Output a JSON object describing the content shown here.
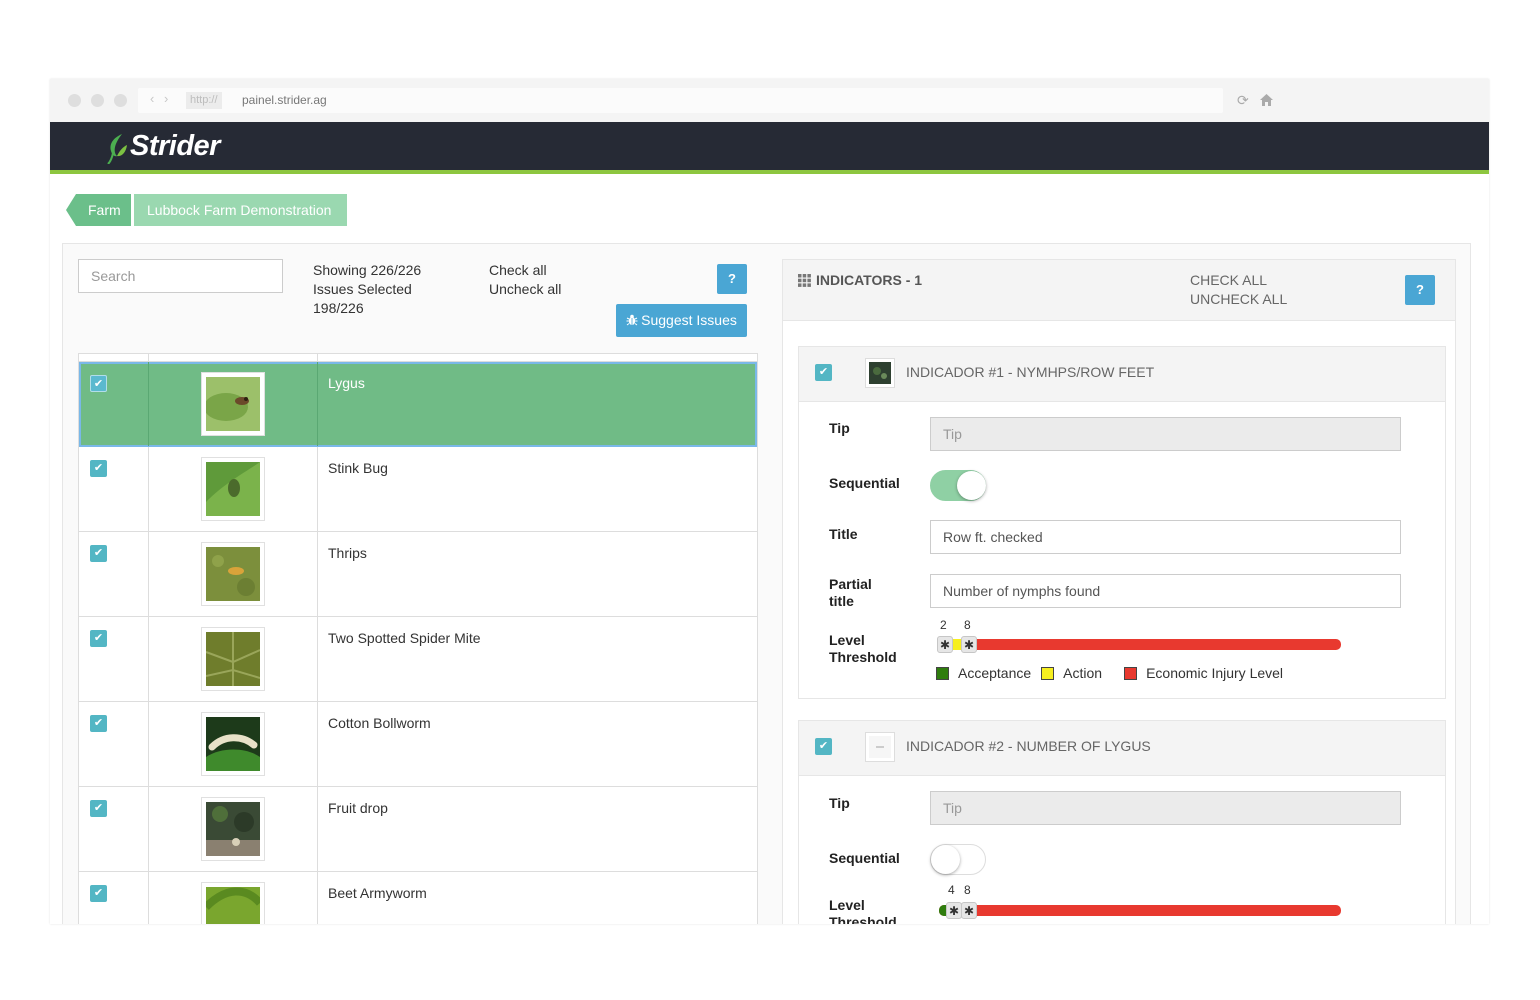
{
  "browser": {
    "protocol": "http://",
    "url": "painel.strider.ag"
  },
  "app": {
    "logo_text": "Strider",
    "brand_color": "#8dc63f",
    "header_color": "#262a35"
  },
  "breadcrumb": {
    "farm_label": "Farm",
    "farm_name": "Lubbock Farm Demonstration"
  },
  "issues": {
    "search_placeholder": "Search",
    "showing_text": "Showing 226/226",
    "selected_text": "Issues Selected 198/226",
    "check_all": "Check all",
    "uncheck_all": "Uncheck all",
    "help_label": "?",
    "suggest_label": "Suggest Issues",
    "rows": [
      {
        "name": "Lygus",
        "checked": true,
        "selected": true,
        "thumb": "lygus-photo"
      },
      {
        "name": "Stink Bug",
        "checked": true,
        "selected": false,
        "thumb": "stink-bug-photo"
      },
      {
        "name": "Thrips",
        "checked": true,
        "selected": false,
        "thumb": "thrips-photo"
      },
      {
        "name": "Two Spotted Spider Mite",
        "checked": true,
        "selected": false,
        "thumb": "spider-mite-photo"
      },
      {
        "name": "Cotton Bollworm",
        "checked": true,
        "selected": false,
        "thumb": "bollworm-photo"
      },
      {
        "name": "Fruit drop",
        "checked": true,
        "selected": false,
        "thumb": "fruit-drop-photo"
      },
      {
        "name": "Beet Armyworm",
        "checked": true,
        "selected": false,
        "thumb": "armyworm-photo"
      }
    ]
  },
  "indicators": {
    "title": "INDICATORS - 1",
    "check_all": "CHECK ALL",
    "uncheck_all": "UNCHECK ALL",
    "help_label": "?",
    "items": [
      {
        "title": "INDICADOR #1 - NYMHPS/ROW FEET",
        "tip_label": "Tip",
        "tip_placeholder": "Tip",
        "sequential_label": "Sequential",
        "sequential": true,
        "title_label": "Title",
        "title_value": "Row ft. checked",
        "partial_label_1": "Partial",
        "partial_label_2": "title",
        "partial_value": "Number of nymphs found",
        "threshold_label_1": "Level",
        "threshold_label_2": "Threshold",
        "low": "2",
        "high": "8",
        "legend_acceptance": "Acceptance",
        "legend_action": "Action",
        "legend_eil": "Economic Injury Level"
      },
      {
        "title": "INDICADOR #2 - NUMBER OF LYGUS",
        "tip_label": "Tip",
        "tip_placeholder": "Tip",
        "sequential_label": "Sequential",
        "sequential": false,
        "threshold_label_1": "Level",
        "threshold_label_2": "Threshold",
        "low": "4",
        "high": "8"
      }
    ]
  },
  "colors": {
    "acceptance": "#2f7d0e",
    "action": "#f7ef1e",
    "eil": "#e8392f",
    "accent": "#4aa6d4",
    "checkbox": "#53b6c4",
    "selected_row": "#70bb86"
  }
}
